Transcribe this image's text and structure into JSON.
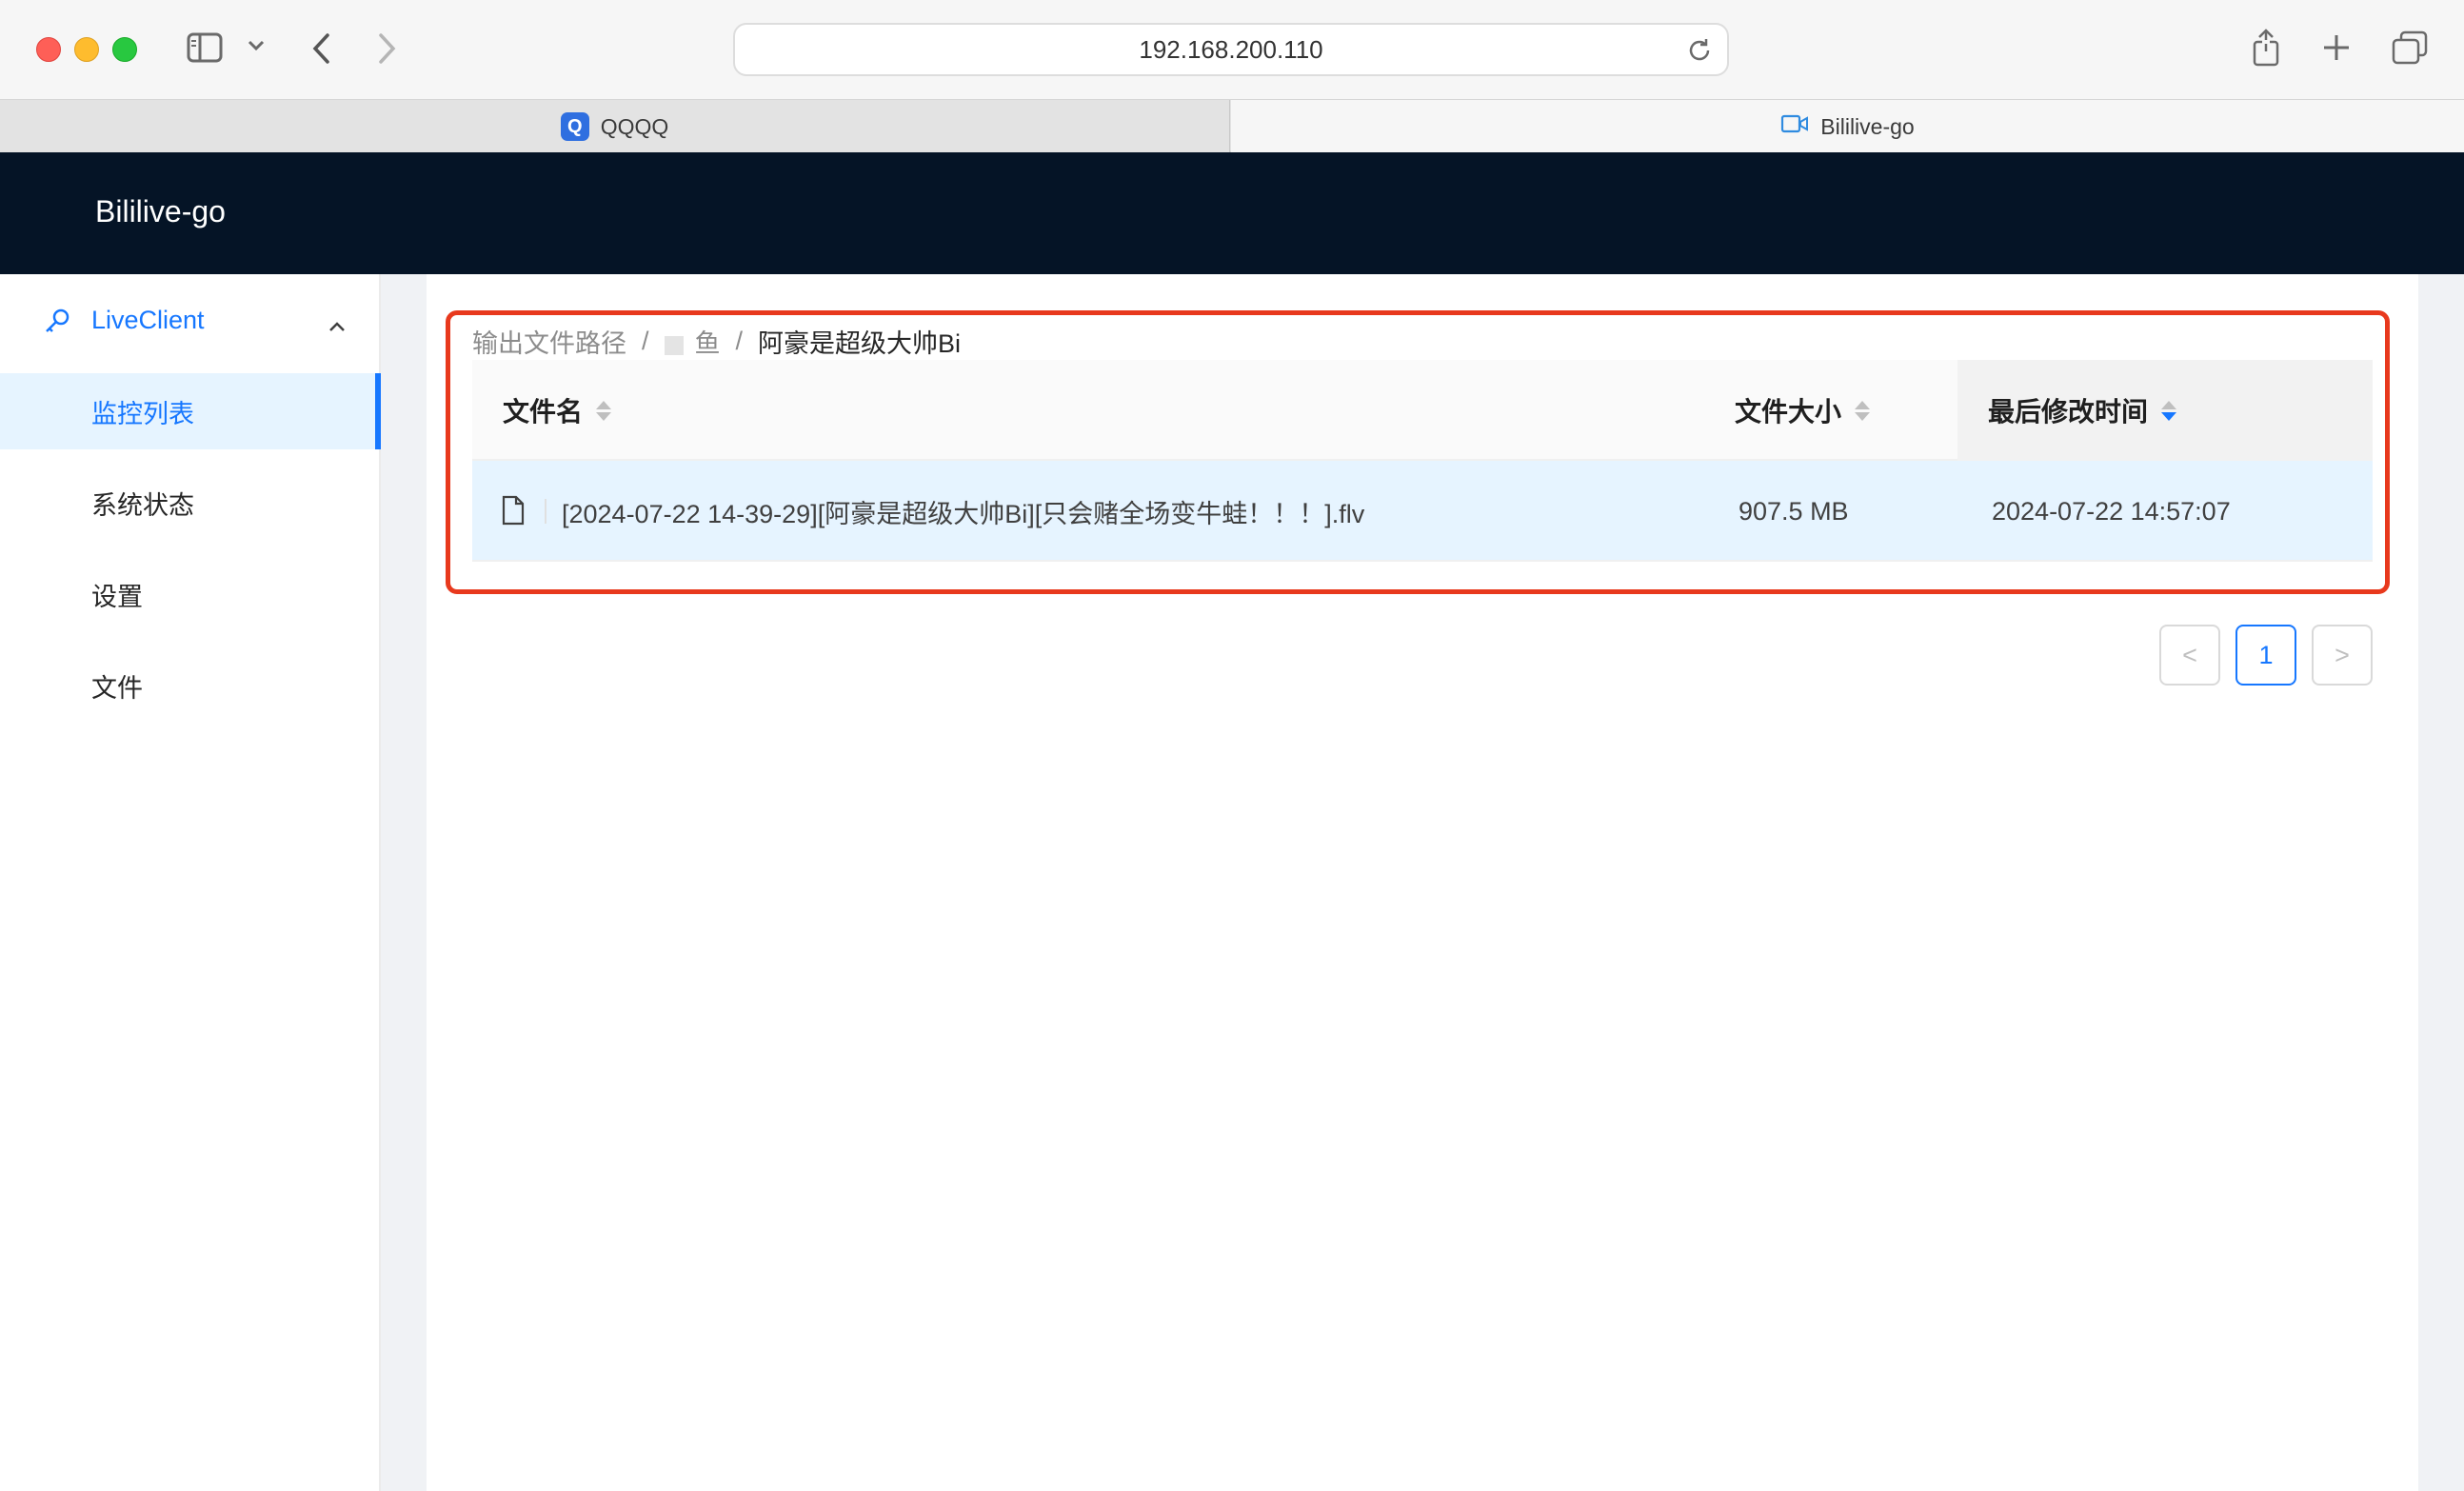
{
  "browser": {
    "address": "192.168.200.110",
    "tabs": [
      {
        "label": "QQQQ",
        "favicon": "Q",
        "active": false
      },
      {
        "label": "Bililive-go",
        "active": true
      }
    ]
  },
  "app": {
    "title": "Bililive-go"
  },
  "sidebar": {
    "group_label": "LiveClient",
    "items": [
      {
        "label": "监控列表",
        "selected": true
      },
      {
        "label": "系统状态"
      },
      {
        "label": "设置"
      },
      {
        "label": "文件"
      }
    ]
  },
  "breadcrumb": {
    "items": [
      "输出文件路径",
      "鱼",
      "阿豪是超级大帅Bi"
    ]
  },
  "table": {
    "columns": [
      {
        "label": "文件名",
        "sort": "none"
      },
      {
        "label": "文件大小",
        "sort": "none"
      },
      {
        "label": "最后修改时间",
        "sort": "descend"
      }
    ],
    "rows": [
      {
        "name": "[2024-07-22 14-39-29][阿豪是超级大帅Bi][只会赌全场变牛蛙！！！].flv",
        "size": "907.5 MB",
        "modified": "2024-07-22 14:57:07"
      }
    ]
  },
  "pagination": {
    "current": "1",
    "prev": "<",
    "next": ">"
  },
  "colors": {
    "accent": "#1677ff",
    "header_bg": "#051426",
    "highlight_border": "#e8391d"
  }
}
